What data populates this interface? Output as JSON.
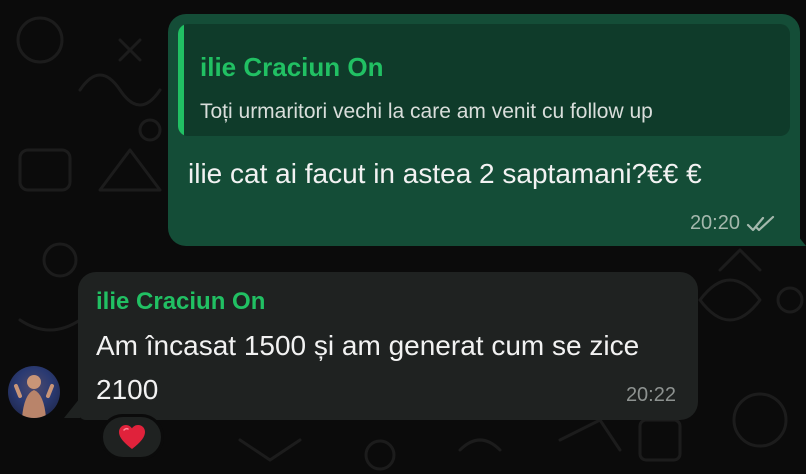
{
  "chat": {
    "outgoing": {
      "quote_author": "ilie Craciun On",
      "quote_text": "Toți urmaritori vechi la care am venit cu follow up",
      "text": "ilie cat ai facut in astea 2 saptamani?€€ €",
      "time": "20:20",
      "status_icon": "double-check-icon"
    },
    "incoming": {
      "author": "ilie Craciun On",
      "text": "Am încasat 1500 și am generat cum se zice 2100",
      "time": "20:22",
      "reaction": "❤️"
    }
  },
  "colors": {
    "background": "#0b0b0b",
    "outgoing_bubble": "#144d37",
    "incoming_bubble": "#1f2221",
    "accent": "#21c063"
  }
}
